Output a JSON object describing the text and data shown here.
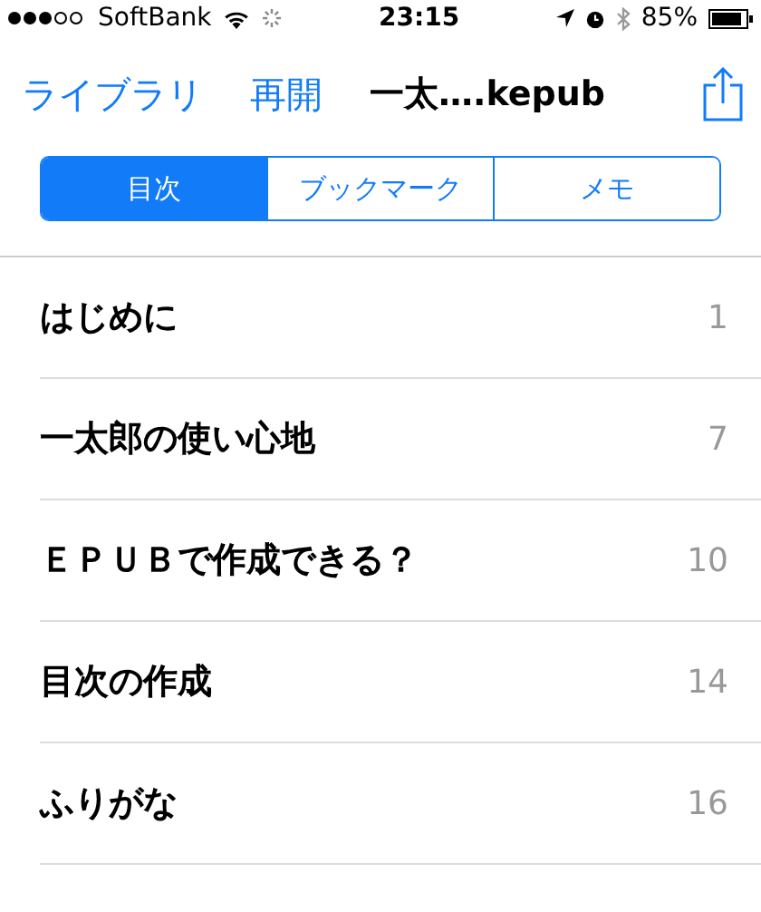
{
  "status_bar": {
    "carrier": "SoftBank",
    "time": "23:15",
    "battery": "85%"
  },
  "nav": {
    "back": "ライブラリ",
    "resume": "再開",
    "title": "一太….kepub"
  },
  "segments": [
    {
      "label": "目次",
      "selected": true
    },
    {
      "label": "ブックマーク",
      "selected": false
    },
    {
      "label": "メモ",
      "selected": false
    }
  ],
  "toc": [
    {
      "title": "はじめに",
      "page": "1"
    },
    {
      "title": "一太郎の使い心地",
      "page": "7"
    },
    {
      "title": "ＥＰＵＢで作成できる？",
      "page": "10"
    },
    {
      "title": "目次の作成",
      "page": "14"
    },
    {
      "title": "ふりがな",
      "page": "16"
    }
  ]
}
